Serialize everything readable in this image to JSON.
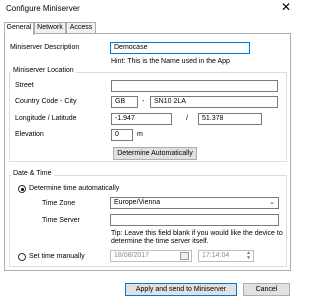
{
  "window": {
    "title": "Configure Miniserver",
    "close_glyph": "✕"
  },
  "tabs": [
    {
      "label": "General"
    },
    {
      "label": "Network"
    },
    {
      "label": "Access"
    }
  ],
  "general": {
    "description_label": "Miniserver Description",
    "description_value": "Democase",
    "description_hint": "Hint: This is the Name used in the App",
    "location_title": "Miniserver Location",
    "street_label": "Street",
    "street_value": "",
    "country_city_label": "Country Code - City",
    "country_value": "GB",
    "dash": "-",
    "city_value": "SN10 2LA",
    "lon_lat_label": "Longitude / Latitude",
    "longitude_value": "-1.947",
    "slash": "/",
    "latitude_value": "51.378",
    "elevation_label": "Elevation",
    "elevation_value": "0",
    "elevation_unit": "m",
    "determine_button": "Determine Automatically"
  },
  "datetime": {
    "title": "Date & Time",
    "auto_label": "Determine time automatically",
    "auto_selected": true,
    "timezone_label": "Time Zone",
    "timezone_value": "Europe/Vienna",
    "timeserver_label": "Time Server",
    "timeserver_value": "",
    "tip_line1": "Tip: Leave this field blank if you would like the device to",
    "tip_line2": "determine the time server itself.",
    "manual_label": "Set time manually",
    "manual_selected": false,
    "date_value": "18/08/2017",
    "time_value": "17:14:04"
  },
  "footer": {
    "apply_button": "Apply and send to Miniserver",
    "cancel_button": "Cancel"
  }
}
